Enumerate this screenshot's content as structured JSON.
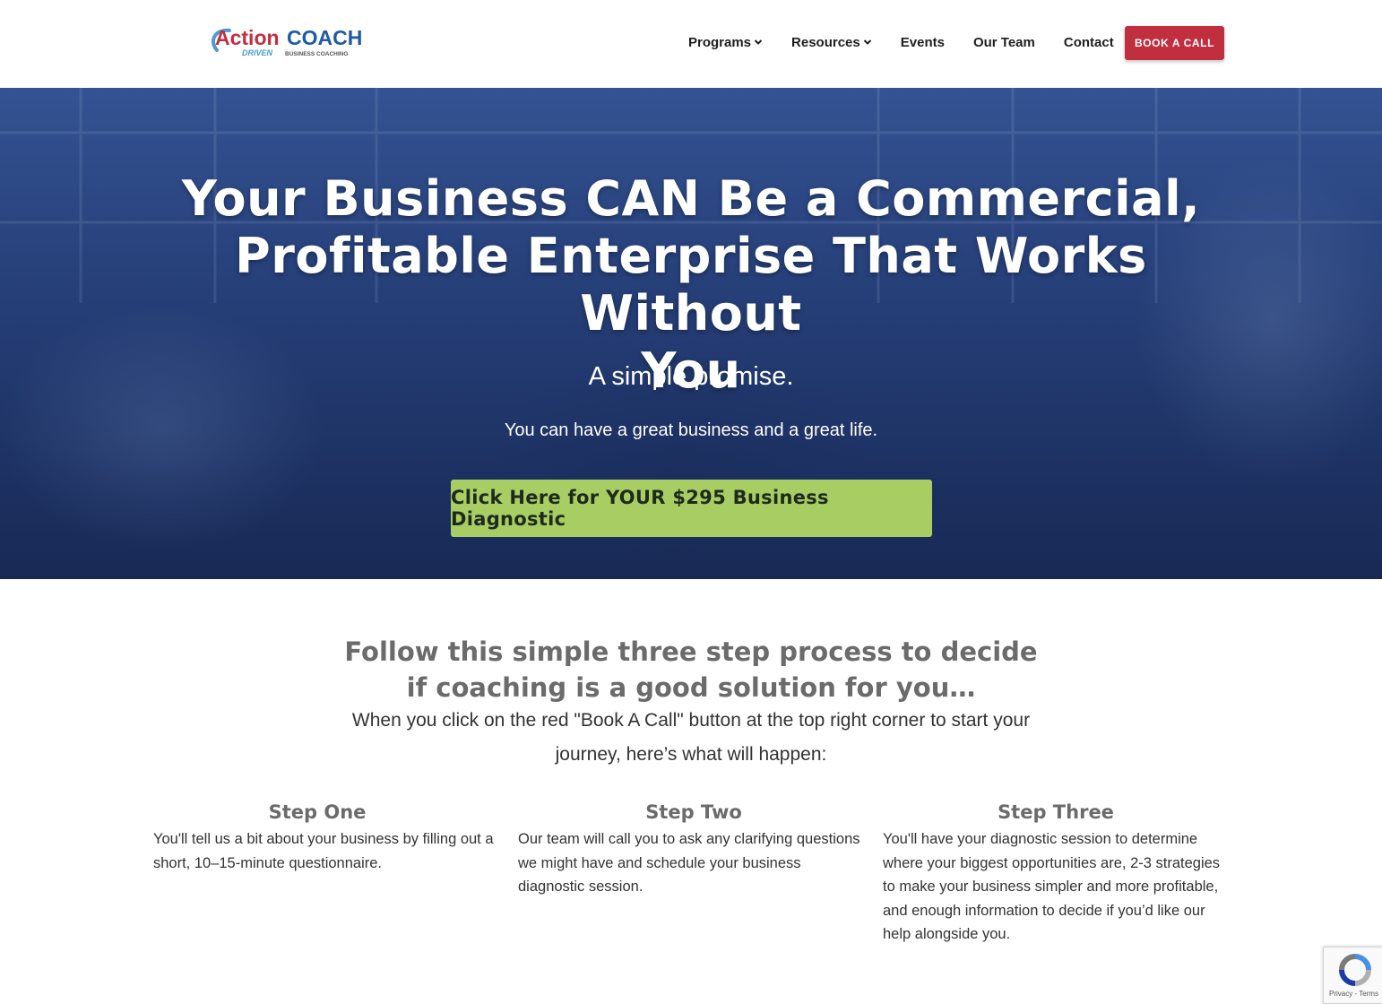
{
  "logo": {
    "brand_action": "Action",
    "brand_coach": "COACH",
    "tagline_driven": "DRIVEN",
    "tagline_rest": "BUSINESS COACHING"
  },
  "nav": {
    "items": [
      {
        "label": "Programs",
        "has_dropdown": true
      },
      {
        "label": "Resources",
        "has_dropdown": true
      },
      {
        "label": "Events",
        "has_dropdown": false
      },
      {
        "label": "Our Team",
        "has_dropdown": false
      },
      {
        "label": "Contact",
        "has_dropdown": false
      }
    ],
    "book_button": "BOOK A CALL"
  },
  "hero": {
    "title_line1": "Your Business CAN Be a Commercial,",
    "title_line2": "Profitable Enterprise That Works Without",
    "title_line3": "You",
    "subtitle": "A simple promise.",
    "line": "You can have a great business and a great life.",
    "cta": "Click Here for YOUR $295 Business Diagnostic"
  },
  "process": {
    "title_line1": "Follow this simple three step process to decide",
    "title_line2": "if coaching is a good solution for you…",
    "intro_line1": "When you click on the red \"Book A Call\" button at the top right corner to start your",
    "intro_line2": "journey, here’s what will happen:",
    "steps": [
      {
        "title": "Step One",
        "text": "You'll tell us a bit about your business by filling out a short, 10–15-minute questionnaire."
      },
      {
        "title": "Step Two",
        "text": "Our team will call you to ask any clarifying questions we might have and schedule your business diagnostic session."
      },
      {
        "title": "Step Three",
        "text": "You'll have your diagnostic session to determine where your biggest opportunities are, 2-3 strategies to make your business simpler and more profitable, and enough information to decide if you’d like our help alongside you."
      }
    ]
  },
  "recaptcha": {
    "label": "Privacy - Terms"
  },
  "colors": {
    "accent_red": "#c12f3f",
    "cta_green": "#a8cd62",
    "hero_blue": "#2e4c8c",
    "logo_blue": "#1f5aa6",
    "logo_red": "#c12f3f"
  }
}
